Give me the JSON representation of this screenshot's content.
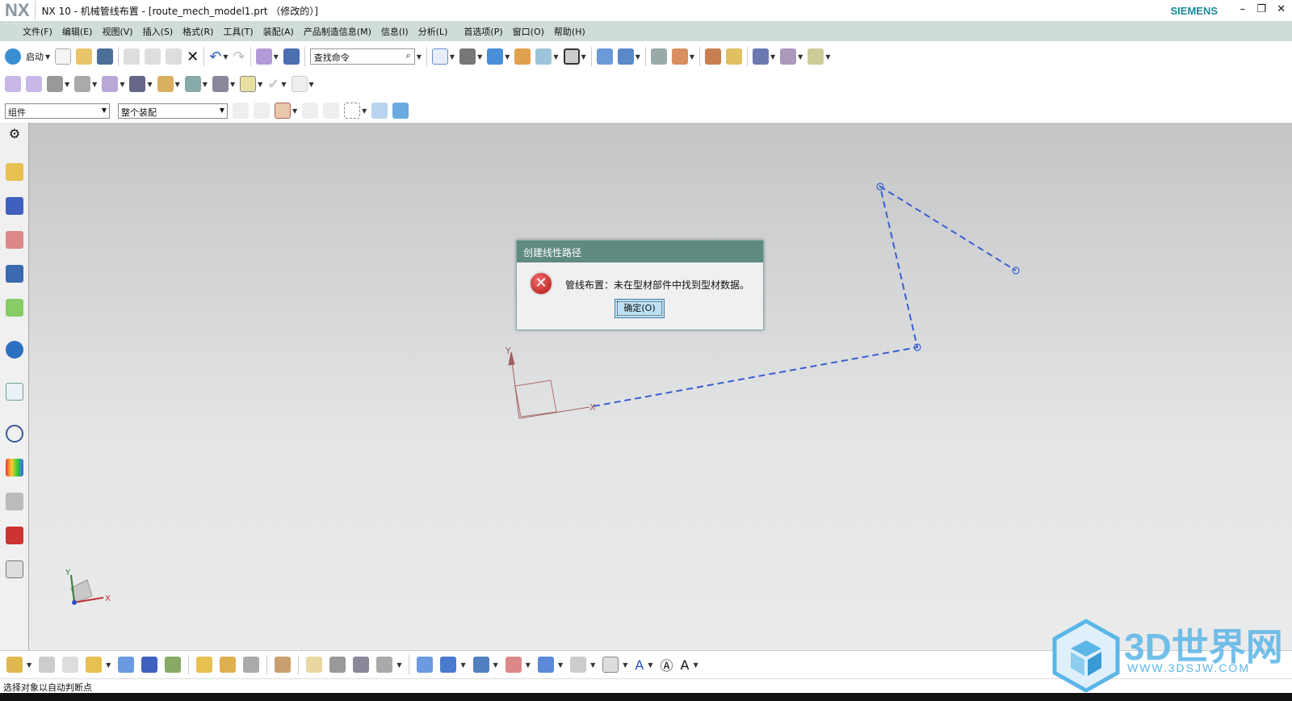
{
  "window": {
    "logo": "NX",
    "title": "NX 10 - 机械管线布置 - [route_mech_model1.prt （修改的）]",
    "brand": "SIEMENS"
  },
  "menu": [
    "文件(F)",
    "编辑(E)",
    "视图(V)",
    "插入(S)",
    "格式(R)",
    "工具(T)",
    "装配(A)",
    "产品制造信息(M)",
    "信息(I)",
    "分析(L)",
    "首选项(P)",
    "窗口(O)",
    "帮助(H)"
  ],
  "toolbar": {
    "start_label": "启动",
    "search_placeholder": "查找命令",
    "filter_select": "组件",
    "scope_select": "整个装配"
  },
  "dialog": {
    "title": "创建线性路径",
    "message": "管线布置：未在型材部件中找到型材数据。",
    "ok_label": "确定(O)",
    "icon": "error-icon"
  },
  "viewport": {
    "wcs_x": "X",
    "wcs_y": "Y",
    "triad_x": "X",
    "triad_y": "Y",
    "path_color": "#3a5fcf"
  },
  "status": {
    "text": "选择对象以自动判断点"
  },
  "watermark": {
    "text": "3D世界网",
    "url": "WWW.3DSJW.COM"
  }
}
